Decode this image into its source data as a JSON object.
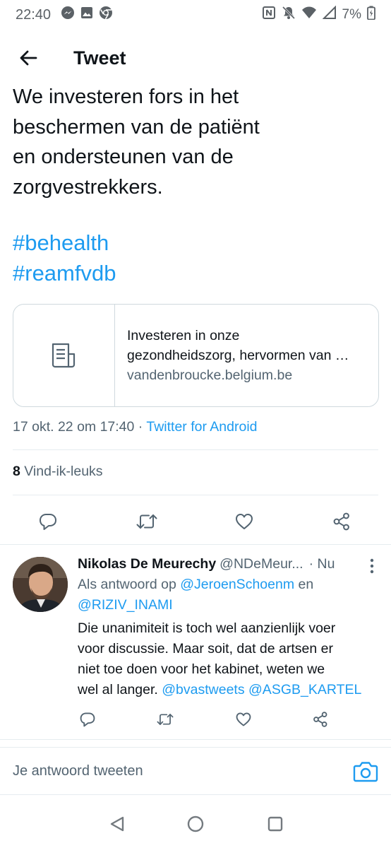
{
  "status_bar": {
    "time": "22:40",
    "battery_percent": "7%",
    "notification_icons": [
      "messenger-icon",
      "image-icon",
      "chrome-icon"
    ],
    "system_icons": [
      "nfc-icon",
      "mute-icon",
      "wifi-icon",
      "signal-icon",
      "battery-charging-icon"
    ]
  },
  "app_bar": {
    "title": "Tweet"
  },
  "tweet": {
    "text_lines": [
      "We investeren fors in het",
      "beschermen van de patiënt",
      "en ondersteunen van de",
      "zorgvestrekkers."
    ],
    "hashtags": [
      "#behealth",
      "#reamfvdb"
    ],
    "link_card": {
      "title_line1": "Investeren in onze",
      "title_line2": "gezondheidszorg, hervormen van …",
      "domain": "vandenbroucke.belgium.be"
    },
    "date": "17 okt. 22 om 17:40",
    "separator": " · ",
    "source": "Twitter for Android",
    "likes_count": "8",
    "likes_label": "Vind-ik-leuks"
  },
  "reply": {
    "name": "Nikolas De Meurechy",
    "handle": "@NDeMeur...",
    "time": "· Nu",
    "in_reply_prefix": "Als antwoord op ",
    "in_reply_mention1": "@JeroenSchoenm",
    "in_reply_and": " en",
    "in_reply_mention2": "@RIZIV_INAMI",
    "text_lines": [
      "Die unanimiteit is toch wel aanzienlijk voer",
      "voor discussie. Maar soit, dat de artsen er",
      "niet toe doen voor het kabinet, weten we"
    ],
    "text_last_prefix": "wel al langer. ",
    "mention_a": "@bvastweets",
    "mention_b": "@ASGB_KARTEL"
  },
  "composer": {
    "placeholder": "Je antwoord tweeten"
  },
  "colors": {
    "accent": "#1d9bf0",
    "text": "#0f1419",
    "secondary": "#536471",
    "border": "#cfd9de"
  }
}
